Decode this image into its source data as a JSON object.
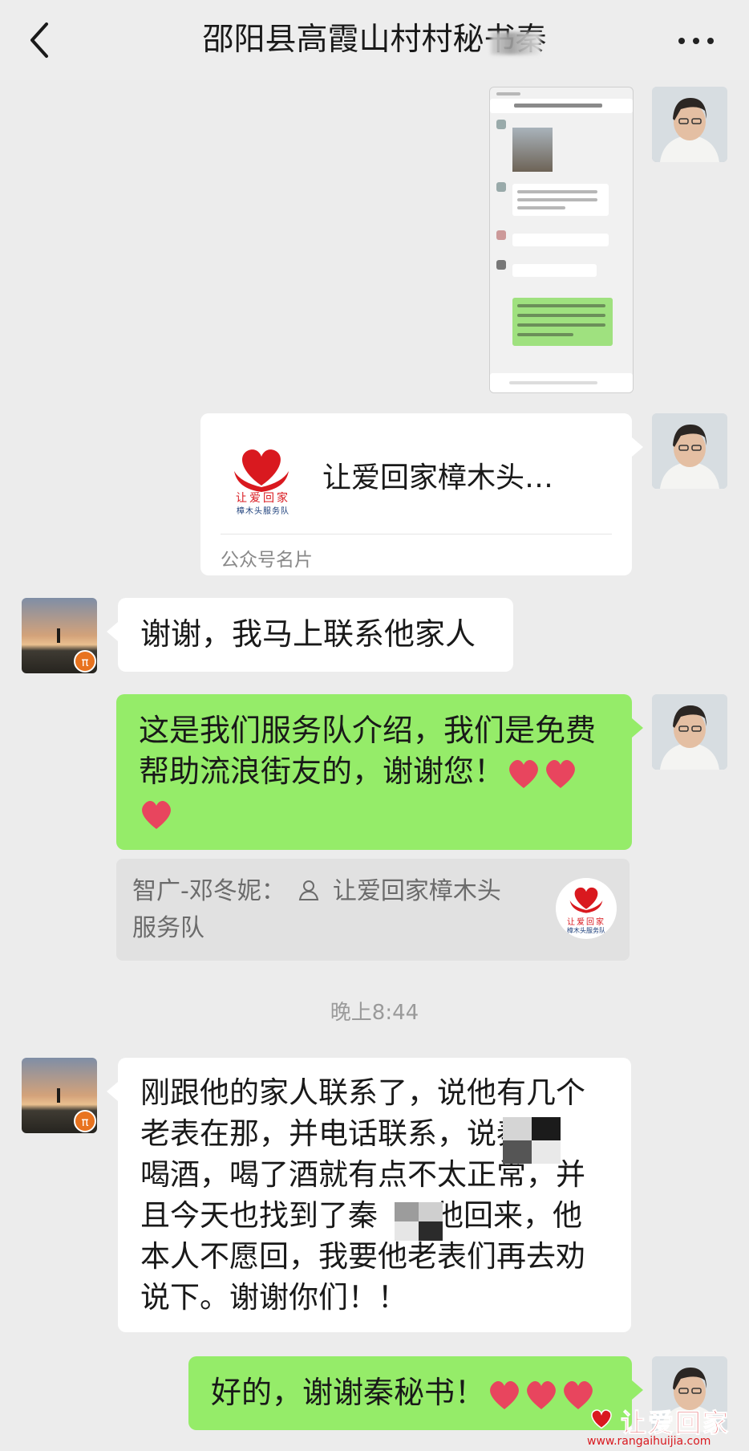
{
  "header": {
    "title": "邵阳县高霞山村村秘书秦",
    "back_icon": "chevron-left-icon",
    "more_icon": "ellipsis-icon"
  },
  "messages": [
    {
      "side": "right",
      "type": "image",
      "description_icon": "screenshot-image"
    },
    {
      "side": "right",
      "type": "card",
      "card_name": "让爱回家樟木头…",
      "card_type": "公众号名片",
      "logo_line1": "让爱回家",
      "logo_line2": "樟木头服务队"
    },
    {
      "side": "left",
      "type": "text",
      "text": "谢谢，我马上联系他家人"
    },
    {
      "side": "right",
      "type": "text",
      "text_line1": "这是我们服务队介绍，我们是免费",
      "text_line2": "帮助流浪街友的，谢谢您！",
      "hearts": 3
    },
    {
      "type": "quote",
      "quote_author": "智广-邓冬妮：",
      "quote_text_1": "让爱回家樟木头",
      "quote_text_2": "服务队",
      "logo_line1": "让爱回家",
      "logo_line2": "樟木头服务队"
    }
  ],
  "time_divider": "晚上8:44",
  "later_messages": [
    {
      "side": "left",
      "type": "text",
      "lines": [
        "刚跟他的家人联系了，说他有几个",
        "老表在那，并电话联系，说秦",
        "喝酒，喝了酒就有点不太正常，并",
        "且今天也找到了秦",
        "他回来，他",
        "本人不愿回，我要他老表们再去劝",
        "说下。谢谢你们！！"
      ]
    },
    {
      "side": "right",
      "type": "text",
      "text": "好的，谢谢秦秘书！",
      "hearts": 3
    }
  ],
  "watermark": {
    "text": "让爱回家",
    "url": "www.rangaihuijia.com"
  },
  "colors": {
    "green_bubble": "#95ec69",
    "background": "#ececec",
    "heart": "#e8455e",
    "logo_red": "#d9191f"
  }
}
